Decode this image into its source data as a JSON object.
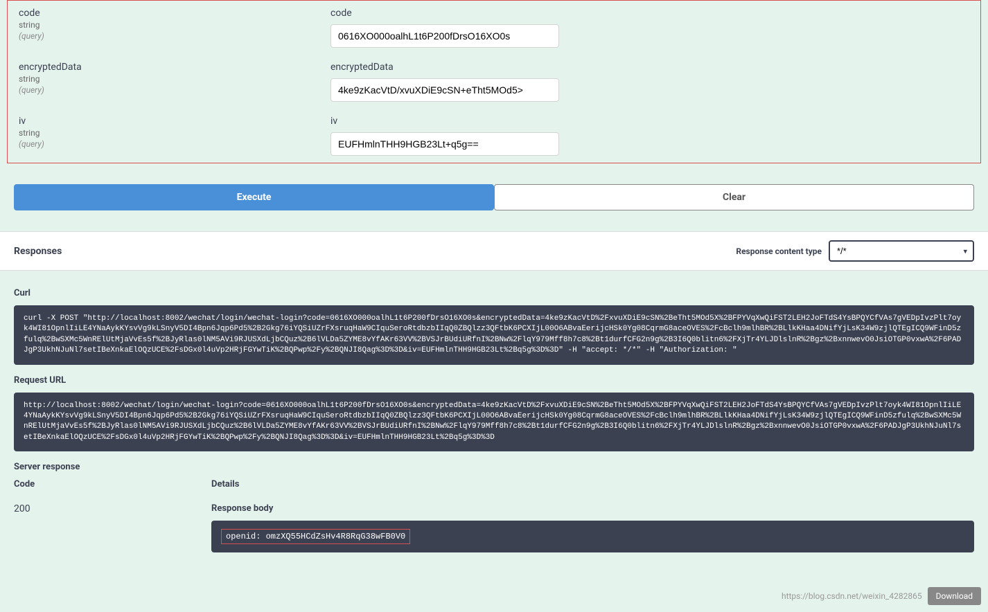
{
  "params": [
    {
      "name": "code",
      "type": "string",
      "loc": "(query)",
      "label": "code",
      "value": "0616XO000oalhL1t6P200fDrsO16XO0s"
    },
    {
      "name": "encryptedData",
      "type": "string",
      "loc": "(query)",
      "label": "encryptedData",
      "value": "4ke9zKacVtD/xvuXDiE9cSN+eTht5MOd5>"
    },
    {
      "name": "iv",
      "type": "string",
      "loc": "(query)",
      "label": "iv",
      "value": "EUFHmlnTHH9HGB23Lt+q5g=="
    }
  ],
  "buttons": {
    "execute": "Execute",
    "clear": "Clear"
  },
  "responses": {
    "title": "Responses",
    "contentTypeLabel": "Response content type",
    "contentTypeValue": "*/*"
  },
  "curl": {
    "title": "Curl",
    "content": "curl -X POST \"http://localhost:8002/wechat/login/wechat-login?code=0616XO000oalhL1t6P200fDrsO16XO0s&encryptedData=4ke9zKacVtD%2FxvuXDiE9cSN%2BeTht5MOd5X%2BFPYVqXwQiFST2LEH2JoFTdS4YsBPQYCfVAs7gVEDpIvzPlt7oyk4WI81OpnlIiLE4YNaAykKYsvVg9kLSnyV5DI4Bpn6Jqp6Pd5%2B2Gkg76iYQSiUZrFXsruqHaW9CIquSeroRtdbzbIIqQ0ZBQlzz3QFtbK6PCXIjL00O6ABvaEerijcHSk0Yg08CqrmG8aceOVES%2FcBclh9mlhBR%2BLlkKHaa4DNifYjLsK34W9zjlQTEgICQ9WFinD5zfulq%2BwSXMc5WnRElUtMjaVvEs5f%2BJyRlas0lNM5AVi9RJUSXdLjbCQuz%2B6lVLDa5ZYME8vYfAKr63VV%2BVSJrBUdiURfnI%2BNw%2FlqY979Mff8h7c8%2Bt1durfCFG2n9g%2B3I6Q0blitn6%2FXjTr4YLJDlslnR%2Bgz%2BxnnwevO0JsiOTGP0vxwA%2F6PADJgP3UkhNJuNl7setIBeXnkaElOQzUCE%2FsDGx0l4uVp2HRjFGYwTiK%2BQPwp%2Fy%2BQNJI8Qag%3D%3D&iv=EUFHmlnTHH9HGB23Lt%2Bq5g%3D%3D\" -H \"accept: */*\" -H \"Authorization: \""
  },
  "requestUrl": {
    "title": "Request URL",
    "content": "http://localhost:8002/wechat/login/wechat-login?code=0616XO000oalhL1t6P200fDrsO16XO0s&encryptedData=4ke9zKacVtD%2FxvuXDiE9cSN%2BeTht5MOd5X%2BFPYVqXwQiFST2LEH2JoFTdS4YsBPQYCfVAs7gVEDpIvzPlt7oyk4WI81OpnlIiLE4YNaAykKYsvVg9kLSnyV5DI4Bpn6Jqp6Pd5%2B2Gkg76iYQSiUZrFXsruqHaW9CIquSeroRtdbzbIIqQ0ZBQlzz3QFtbK6PCXIjL00O6ABvaEerijcHSk0Yg08CqrmG8aceOVES%2FcBclh9mlhBR%2BLlkKHaa4DNifYjLsK34W9zjlQTEgICQ9WFinD5zfulq%2BwSXMc5WnRElUtMjaVvEs5f%2BJyRlas0lNM5AVi9RJUSXdLjbCQuz%2B6lVLDa5ZYME8vYfAKr63VV%2BVSJrBUdiURfnI%2BNw%2FlqY979Mff8h7c8%2Bt1durfCFG2n9g%2B3I6Q0blitn6%2FXjTr4YLJDlslnR%2Bgz%2BxnnwevO0JsiOTGP0vxwA%2F6PADJgP3UkhNJuNl7setIBeXnkaElOQzUCE%2FsDGx0l4uVp2HRjFGYwTiK%2BQPwp%2Fy%2BQNJI8Qag%3D%3D&iv=EUFHmlnTHH9HGB23Lt%2Bq5g%3D%3D"
  },
  "serverResponse": {
    "title": "Server response",
    "codeHeader": "Code",
    "detailsHeader": "Details",
    "code": "200",
    "bodyLabel": "Response body",
    "bodyContent": "openid: omzXQ55HCdZsHv4R8RqG38wFB0V0"
  },
  "watermark": {
    "url": "https://blog.csdn.net/weixin_4282865",
    "download": "Download"
  }
}
